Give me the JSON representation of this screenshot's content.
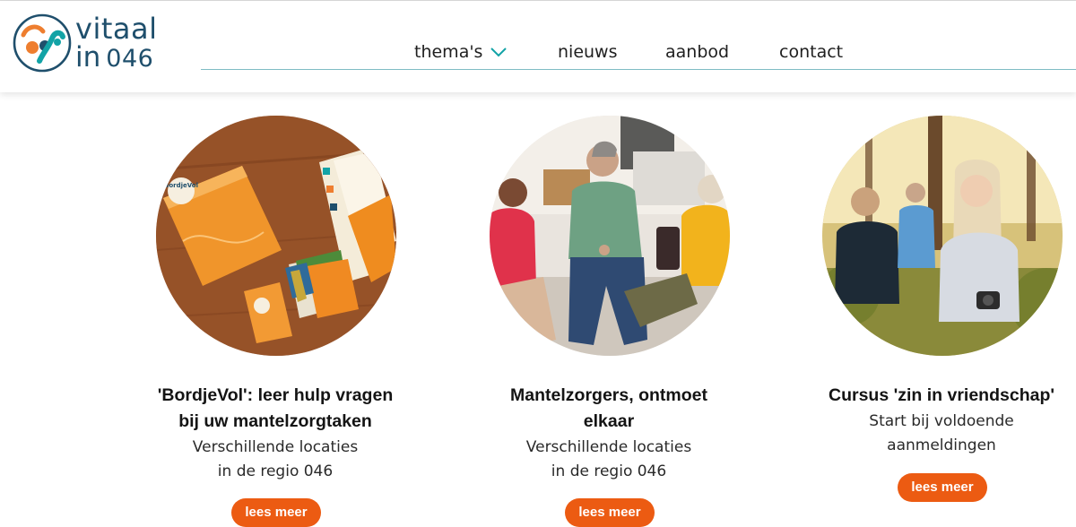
{
  "brand": {
    "word_line1": "vitaal",
    "word_line2_prefix": "in",
    "word_line2_number": "046",
    "colors": {
      "navy": "#1f4f6c",
      "teal": "#12a3a6",
      "orange": "#ee7e2f",
      "accent_button": "#ec5b12"
    }
  },
  "nav": {
    "items": [
      {
        "label": "thema's",
        "icon": "chevron-down-icon"
      },
      {
        "label": "nieuws"
      },
      {
        "label": "aanbod"
      },
      {
        "label": "contact"
      }
    ]
  },
  "cards": [
    {
      "image": "bordjevol-box-and-cards-photo",
      "image_text": "BordjeVol",
      "title_line1": "'BordjeVol': leer hulp vragen",
      "title_line2": "bij uw mantelzorgtaken",
      "sub_line1": "Verschillende locaties",
      "sub_line2": "in de regio 046",
      "button": "lees meer"
    },
    {
      "image": "caregivers-group-conversation-photo",
      "title_line1": "Mantelzorgers, ontmoet",
      "title_line2": "elkaar",
      "sub_line1": "Verschillende locaties",
      "sub_line2": "in de regio 046",
      "button": "lees meer"
    },
    {
      "image": "women-hiking-in-forest-photo",
      "title_line1": "Cursus 'zin in vriendschap'",
      "sub_line1": "Start bij voldoende",
      "sub_line2": "aanmeldingen",
      "button": "lees meer"
    }
  ]
}
